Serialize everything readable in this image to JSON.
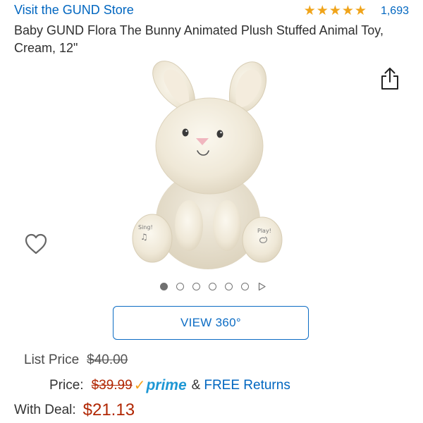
{
  "header": {
    "store_link": "Visit the GUND Store",
    "rating": {
      "stars": 5,
      "count": "1,693"
    }
  },
  "product": {
    "title": "Baby GUND Flora The Bunny Animated Plush Stuffed Animal Toy, Cream, 12\"",
    "paw_left_text": "Sing!",
    "paw_right_text": "Play!"
  },
  "icons": {
    "share": "share-icon",
    "wishlist": "heart-icon",
    "play": "play-icon",
    "star": "star-icon",
    "prime_check": "prime-check-icon"
  },
  "gallery": {
    "dot_count": 6,
    "active_index": 0
  },
  "view360": {
    "label": "VIEW 360°"
  },
  "pricing": {
    "list_label": "List Price",
    "list_price": "$40.00",
    "price_label": "Price:",
    "price": "$39.99",
    "prime_word": "prime",
    "amp": "&",
    "free_returns": "FREE Returns",
    "deal_label": "With Deal:",
    "deal_price": "$21.13"
  },
  "colors": {
    "link": "#0066c0",
    "star": "#f0a41a",
    "deal_red": "#b12704",
    "prime_blue": "#1e97d4",
    "prime_orange": "#f7a21a",
    "button_border": "#0c6cc4"
  }
}
